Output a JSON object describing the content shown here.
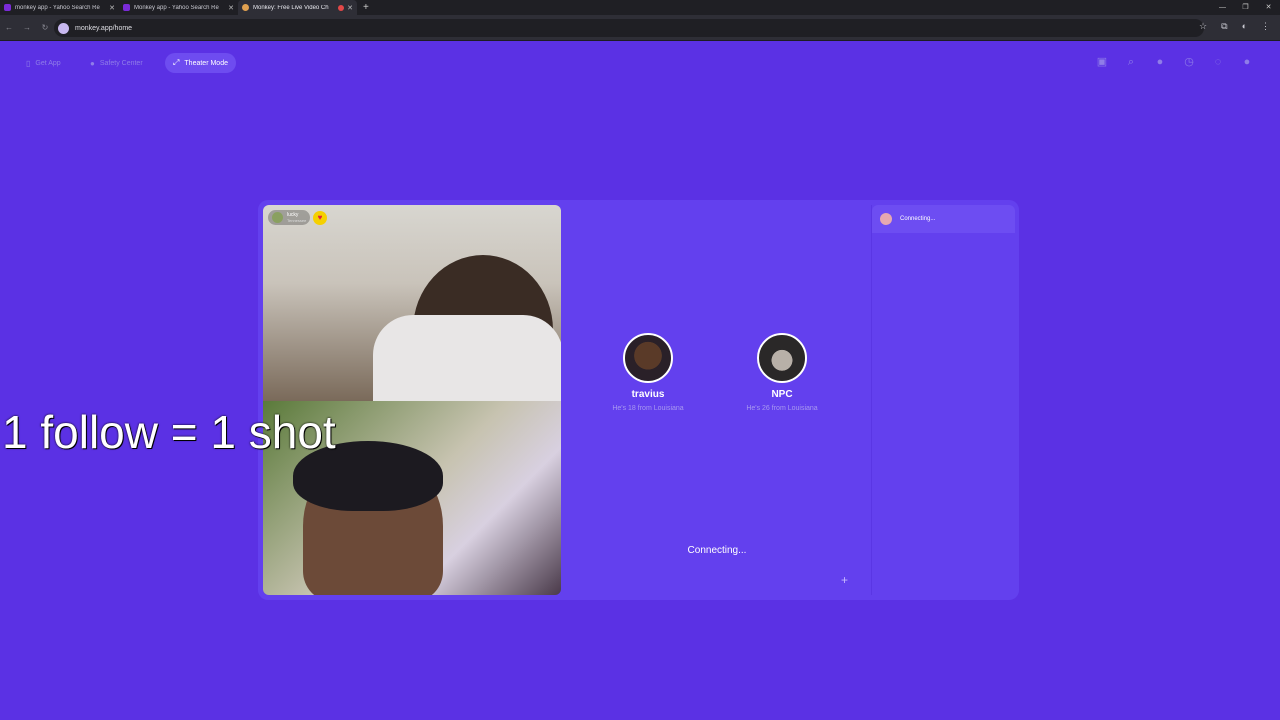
{
  "browser": {
    "tabs": [
      {
        "title": "monkey app - Yahoo Search Re",
        "favicon": "yahoo-icon"
      },
      {
        "title": "Monkey app - Yahoo Search Re",
        "favicon": "yahoo-icon"
      },
      {
        "title": "Monkey: Free Live Video Ch",
        "favicon": "monkey-icon",
        "active": true,
        "recording": true
      }
    ],
    "url": "monkey.app/home"
  },
  "appbar": {
    "get_app": "Get App",
    "safety_center": "Safety Center",
    "theater_mode": "Theater Mode"
  },
  "remote_video": {
    "name": "lucky",
    "location": "Tennessee"
  },
  "suggestions": [
    {
      "name": "travius",
      "info": "He's 18 from Louisiana"
    },
    {
      "name": "NPC",
      "info": "He's 26 from Louisiana"
    }
  ],
  "status": "Connecting...",
  "chat": {
    "status": "Connecting..."
  },
  "overlay_text": "1 follow = 1 shot",
  "colors": {
    "background": "#5b31e4",
    "panel": "#6340ee",
    "accent": "#6e4cf0"
  }
}
